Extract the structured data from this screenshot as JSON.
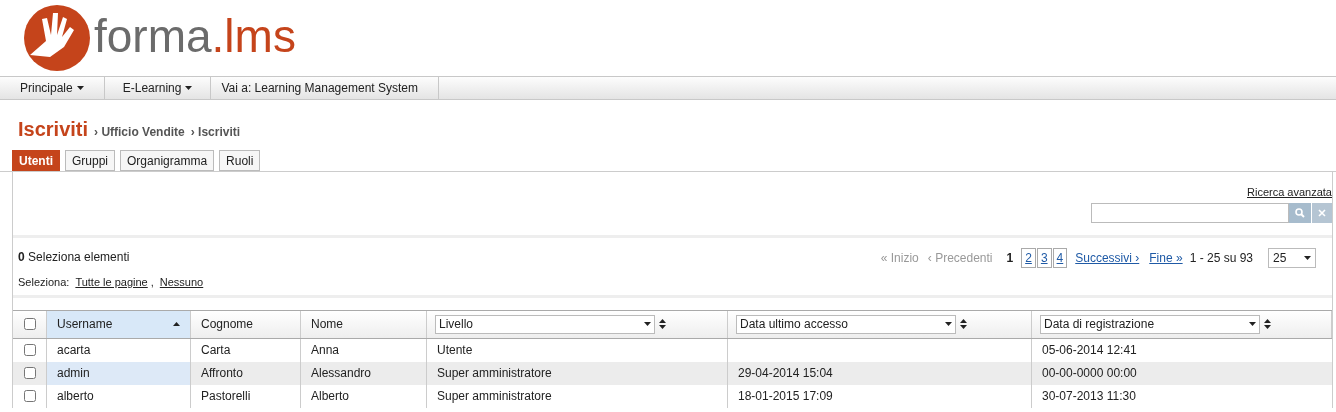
{
  "logo": {
    "word": "forma",
    "suffix": ".lms"
  },
  "menu": [
    {
      "label": "Principale",
      "dropdown": true
    },
    {
      "label": "E-Learning",
      "dropdown": true
    },
    {
      "label": "Vai a: Learning Management System",
      "dropdown": false
    }
  ],
  "page_title": "Iscriviti",
  "breadcrumb": [
    "› Ufficio Vendite",
    "› Iscriviti"
  ],
  "tabs": [
    {
      "label": "Utenti",
      "selected": true
    },
    {
      "label": "Gruppi",
      "selected": false
    },
    {
      "label": "Organigramma",
      "selected": false
    },
    {
      "label": "Ruoli",
      "selected": false
    }
  ],
  "advanced_search": "Ricerca avanzata",
  "selection": {
    "count": "0",
    "label": "Seleziona elementi",
    "select_label": "Seleziona:",
    "links": [
      "Tutte le pagine",
      "Nessuno"
    ],
    "separator": ","
  },
  "pagination": {
    "items": [
      {
        "kind": "disabled",
        "label": "« Inizio"
      },
      {
        "kind": "disabled",
        "label": "‹ Precedenti"
      },
      {
        "kind": "current",
        "label": "1"
      },
      {
        "kind": "page",
        "label": "2"
      },
      {
        "kind": "page",
        "label": "3"
      },
      {
        "kind": "page",
        "label": "4"
      },
      {
        "kind": "link",
        "label": "Successivi ›"
      },
      {
        "kind": "link",
        "label": "Fine »"
      }
    ],
    "range": "1 - 25 su 93",
    "per_page": "25"
  },
  "table": {
    "select_all_checked": false,
    "columns": [
      {
        "kind": "sortable",
        "label": "Username",
        "selected": true
      },
      {
        "kind": "plain",
        "label": "Cognome",
        "selected": false
      },
      {
        "kind": "plain",
        "label": "Nome",
        "selected": false
      },
      {
        "kind": "select",
        "label": "Livello",
        "selected": false
      },
      {
        "kind": "select",
        "label": "Data ultimo accesso",
        "selected": false
      },
      {
        "kind": "select",
        "label": "Data di registrazione",
        "selected": false
      }
    ],
    "rows": [
      {
        "checked": false,
        "hovered": false,
        "cells": [
          "acarta",
          "Carta",
          "Anna",
          "Utente",
          "",
          "05-06-2014 12:41"
        ]
      },
      {
        "checked": false,
        "hovered": true,
        "cells": [
          "admin",
          "Affronto",
          "Alessandro",
          "Super amministratore",
          "29-04-2014 15:04",
          "00-00-0000 00:00"
        ]
      },
      {
        "checked": false,
        "hovered": false,
        "cells": [
          "alberto",
          "Pastorelli",
          "Alberto",
          "Super amministratore",
          "18-01-2015 17:09",
          "30-07-2013 11:30"
        ]
      }
    ]
  }
}
